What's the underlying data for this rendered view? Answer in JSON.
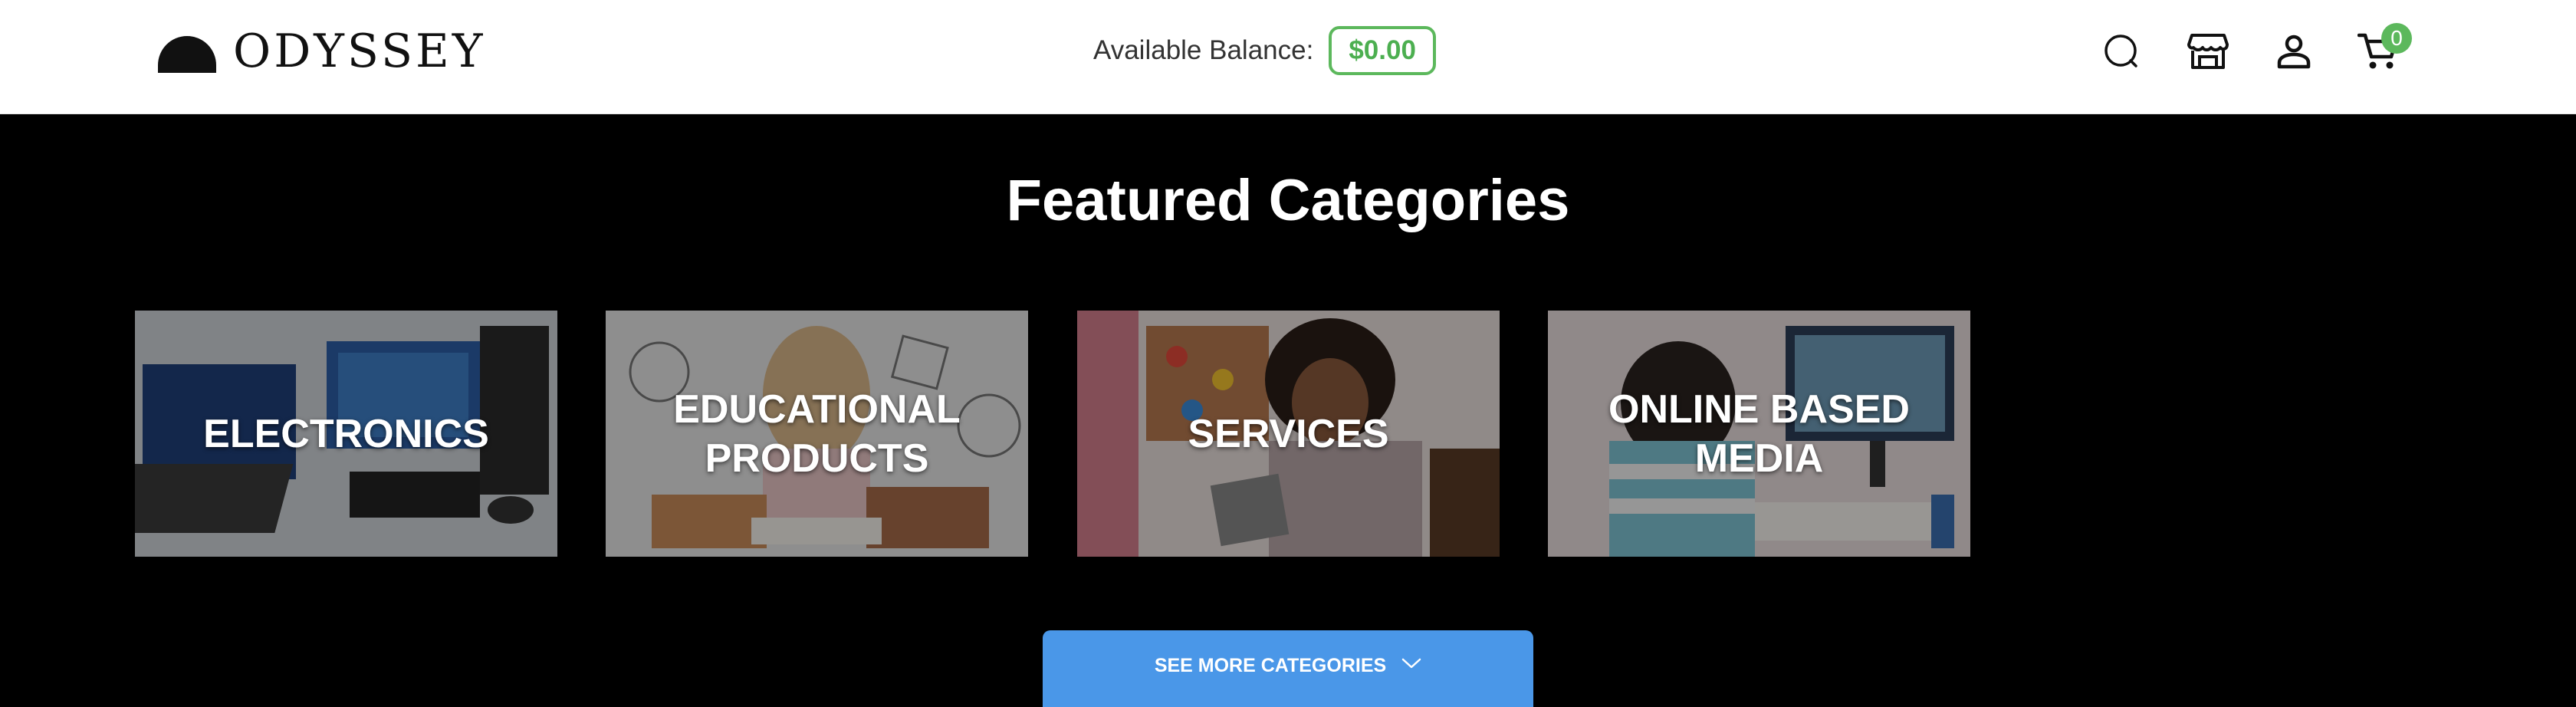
{
  "header": {
    "logo_text": "ODYSSEY",
    "balance_label": "Available Balance:",
    "balance_amount": "$0.00",
    "cart_count": "0",
    "icons": [
      "search-icon",
      "store-icon",
      "account-icon",
      "cart-icon"
    ]
  },
  "colors": {
    "accent_green": "#5cb85c",
    "button_blue": "#4a97e8",
    "page_background": "#000000"
  },
  "featured": {
    "title": "Featured Categories",
    "categories": [
      {
        "label": "ELECTRONICS"
      },
      {
        "label": "EDUCATIONAL PRODUCTS"
      },
      {
        "label": "SERVICES"
      },
      {
        "label": "ONLINE BASED MEDIA"
      }
    ],
    "see_more_label": "SEE MORE CATEGORIES"
  }
}
